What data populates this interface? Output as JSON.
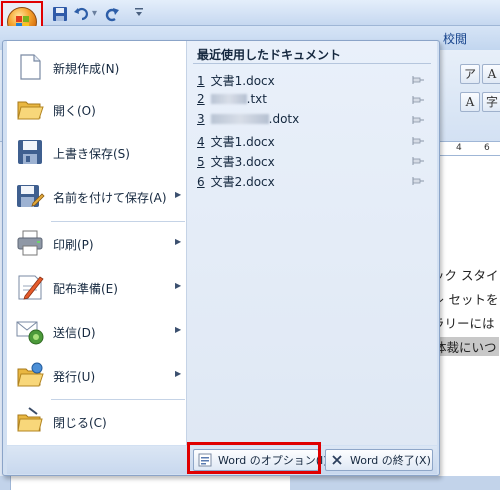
{
  "ribbon": {
    "tab_review": "校閲"
  },
  "quick_access": {
    "office_button": "office-button",
    "save_icon": "save-icon",
    "undo_icon": "undo-icon",
    "redo_icon": "redo-icon",
    "customize_icon": "customize-qat-icon"
  },
  "ruler_ticks": [
    "4",
    "6"
  ],
  "document_lines": [
    "ック スタイ",
    "レ セットを",
    "ラリーには",
    "体裁にいつ"
  ],
  "menu": {
    "items": [
      {
        "label": "新規作成(N)",
        "icon": "new-document-icon",
        "has_submenu": false
      },
      {
        "label": "開く(O)",
        "icon": "open-folder-icon",
        "has_submenu": false
      },
      {
        "label": "上書き保存(S)",
        "icon": "save-icon",
        "has_submenu": false
      },
      {
        "label": "名前を付けて保存(A)",
        "icon": "save-as-icon",
        "has_submenu": true
      },
      {
        "label": "印刷(P)",
        "icon": "printer-icon",
        "has_submenu": true
      },
      {
        "label": "配布準備(E)",
        "icon": "prepare-icon",
        "has_submenu": true
      },
      {
        "label": "送信(D)",
        "icon": "send-icon",
        "has_submenu": true
      },
      {
        "label": "発行(U)",
        "icon": "publish-icon",
        "has_submenu": true
      },
      {
        "label": "閉じる(C)",
        "icon": "close-document-icon",
        "has_submenu": false
      }
    ],
    "recent": {
      "title": "最近使用したドキュメント",
      "items": [
        {
          "num": "1",
          "name": "文書1.docx",
          "redacted": false
        },
        {
          "num": "2",
          "name": ".txt",
          "redacted": true
        },
        {
          "num": "3",
          "name": ".dotx",
          "redacted": true
        },
        {
          "num": "4",
          "name": "文書1.docx",
          "redacted": false
        },
        {
          "num": "5",
          "name": "文書3.docx",
          "redacted": false
        },
        {
          "num": "6",
          "name": "文書2.docx",
          "redacted": false
        }
      ]
    },
    "options_button": "Word のオプション(I)",
    "exit_button": "Word の終了(X)"
  },
  "colors": {
    "highlight": "#e00000",
    "menu_background": "#d2e0f2",
    "accent": "#15428b"
  }
}
